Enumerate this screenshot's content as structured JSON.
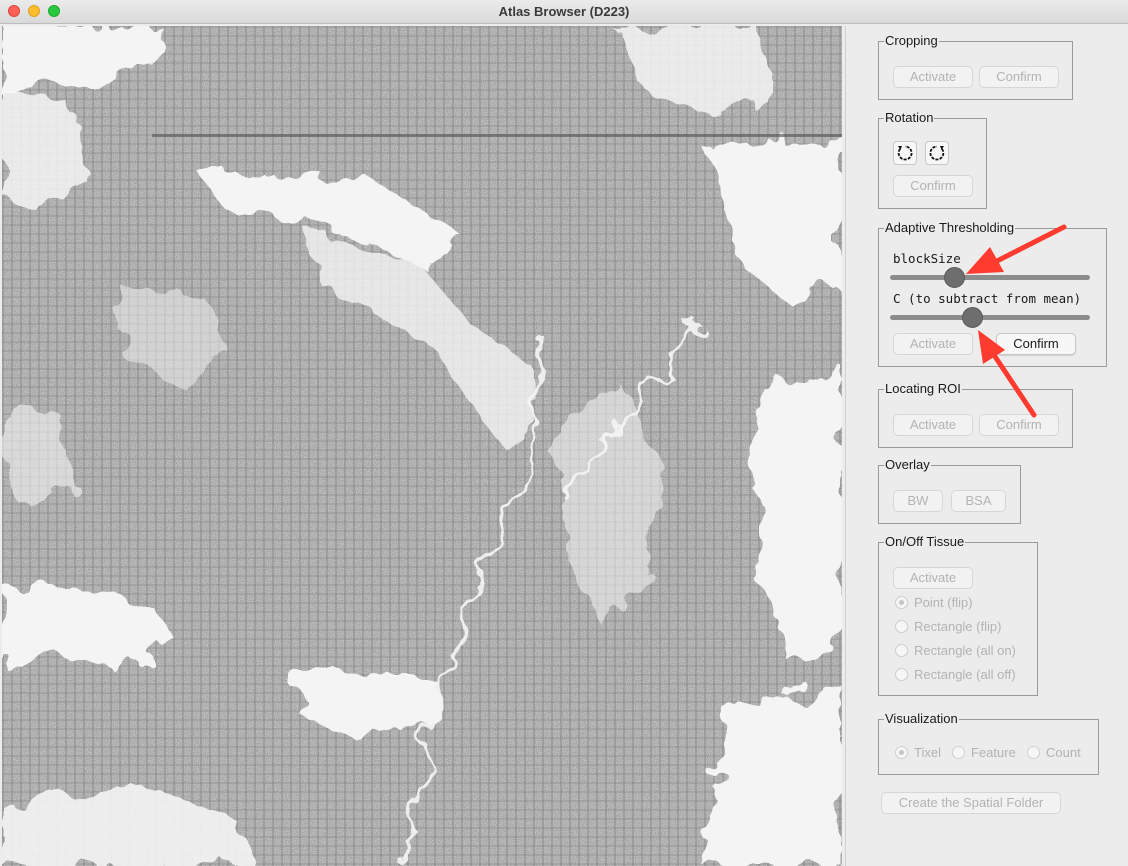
{
  "window": {
    "title": "Atlas Browser (D223)"
  },
  "canvas": {
    "description_icon": "tissue-image"
  },
  "panel": {
    "cropping": {
      "title": "Cropping",
      "activate": "Activate",
      "confirm": "Confirm"
    },
    "rotation": {
      "title": "Rotation",
      "confirm": "Confirm",
      "icons": [
        "rotate-left-icon",
        "rotate-right-icon"
      ]
    },
    "adaptive": {
      "title": "Adaptive Thresholding",
      "block_label": "blockSize",
      "c_label": "C (to subtract from mean)",
      "block_value": 0.32,
      "c_value": 0.41,
      "activate": "Activate",
      "confirm": "Confirm"
    },
    "roi": {
      "title": "Locating ROI",
      "activate": "Activate",
      "confirm": "Confirm"
    },
    "overlay": {
      "title": "Overlay",
      "bw": "BW",
      "bsa": "BSA"
    },
    "tissue": {
      "title": "On/Off Tissue",
      "activate": "Activate",
      "options": [
        "Point (flip)",
        "Rectangle (flip)",
        "Rectangle (all on)",
        "Rectangle (all off)"
      ],
      "selected": "Point (flip)"
    },
    "visualization": {
      "title": "Visualization",
      "options": [
        "Tixel",
        "Feature",
        "Count"
      ],
      "selected": "Tixel"
    },
    "create_folder": "Create the Spatial Folder"
  },
  "colors": {
    "annotation_arrow": "#ff3b30",
    "close": "#fe5f57",
    "minimize": "#febc2e",
    "maximize": "#28c840"
  }
}
